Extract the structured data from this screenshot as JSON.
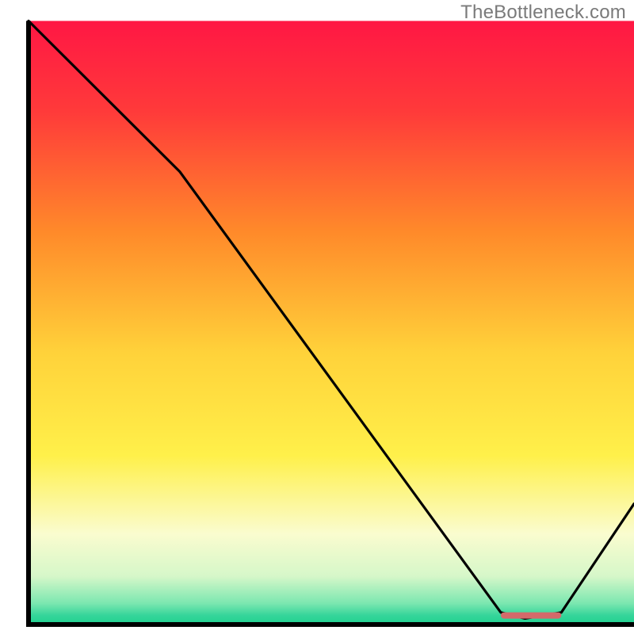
{
  "watermark": "TheBottleneck.com",
  "chart_data": {
    "type": "line",
    "title": "",
    "xlabel": "",
    "ylabel": "",
    "xlim": [
      0,
      100
    ],
    "ylim": [
      0,
      100
    ],
    "grid": false,
    "legend": false,
    "x": [
      0,
      25,
      78,
      82,
      88,
      100
    ],
    "values": [
      100,
      75,
      2,
      1,
      2,
      20
    ],
    "optimum_marker": {
      "x_start": 78,
      "x_end": 88,
      "y": 1.5,
      "color": "#d46a6a"
    },
    "annotations": [],
    "background_gradient": {
      "stops": [
        {
          "offset": 0.0,
          "color": "#ff1744"
        },
        {
          "offset": 0.15,
          "color": "#ff3a3a"
        },
        {
          "offset": 0.35,
          "color": "#ff8a2a"
        },
        {
          "offset": 0.55,
          "color": "#ffd23a"
        },
        {
          "offset": 0.72,
          "color": "#fff04a"
        },
        {
          "offset": 0.85,
          "color": "#fafccf"
        },
        {
          "offset": 0.92,
          "color": "#d6f7c9"
        },
        {
          "offset": 0.965,
          "color": "#7be7b0"
        },
        {
          "offset": 0.985,
          "color": "#35d59a"
        },
        {
          "offset": 1.0,
          "color": "#1fd18f"
        }
      ]
    },
    "axis": {
      "left_x": 4.5,
      "bottom_y": 98.5,
      "top_y": 3.3,
      "right_x": 100
    }
  }
}
